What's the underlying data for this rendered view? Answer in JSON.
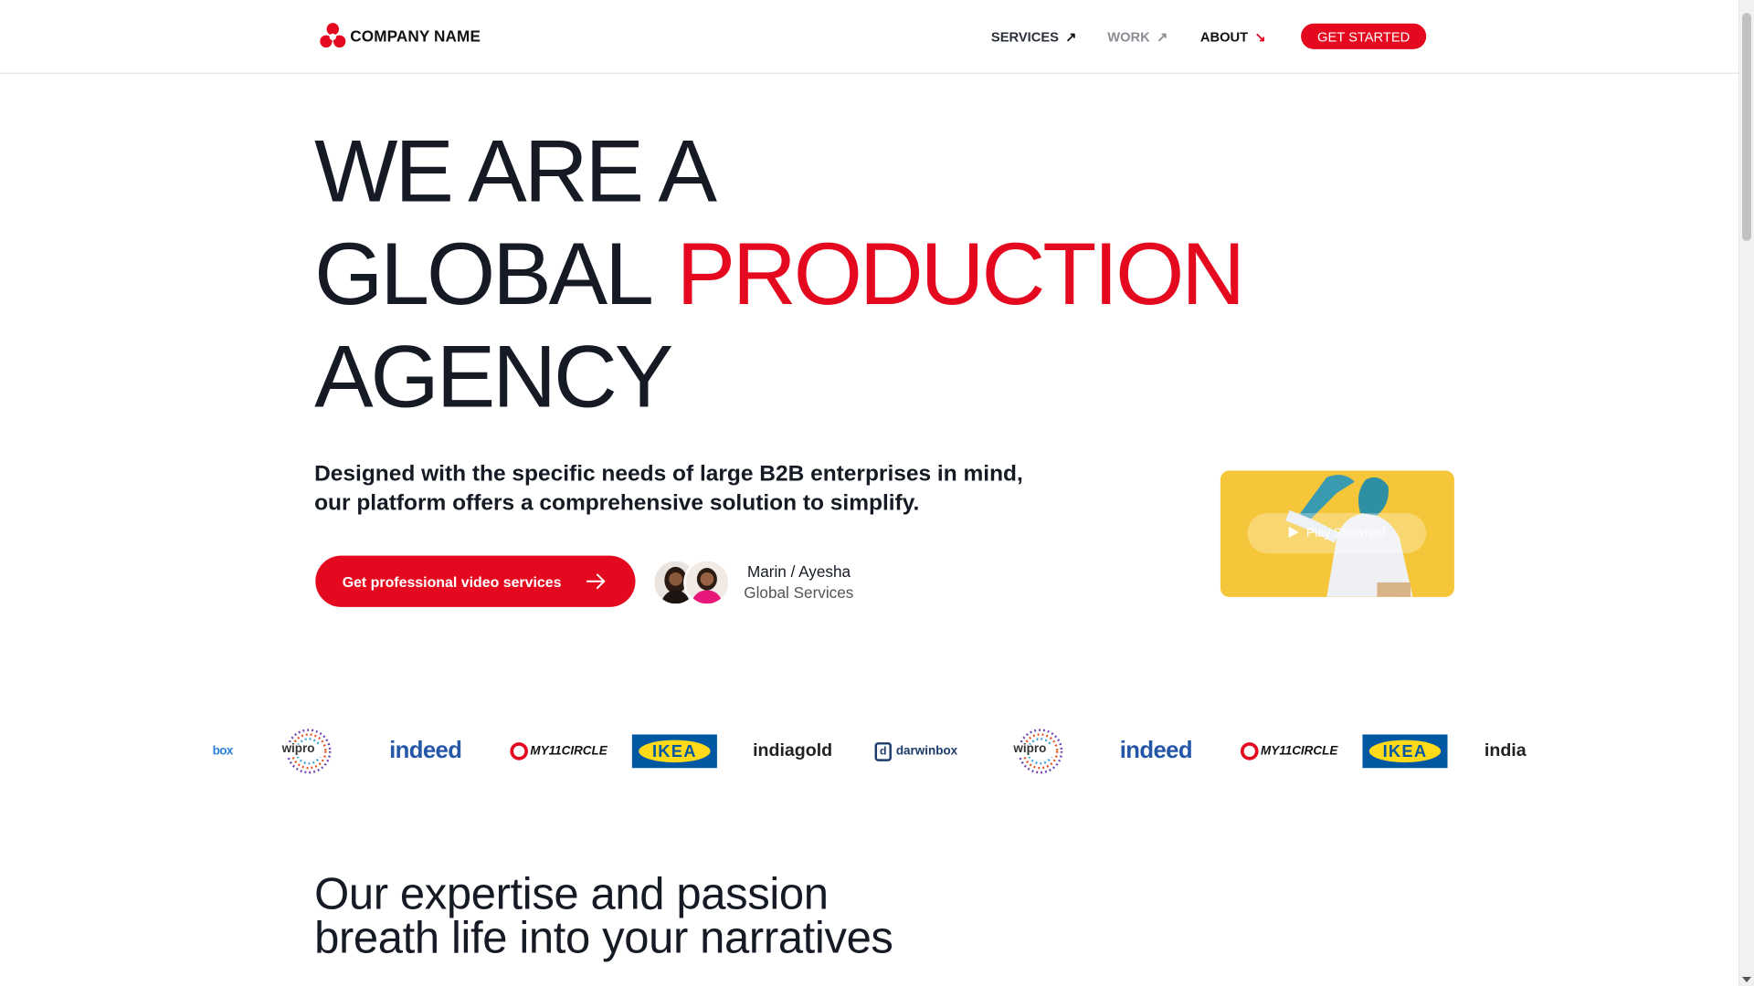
{
  "header": {
    "logo_text": "COMPANY NAME",
    "nav": [
      {
        "label": "SERVICES",
        "arrow": "↗"
      },
      {
        "label": "WORK",
        "arrow": "↗"
      },
      {
        "label": "ABOUT",
        "arrow": "↘"
      }
    ],
    "cta": "GET STARTED"
  },
  "hero": {
    "line1": "WE ARE A",
    "line2a": "GLOBAL",
    "line2b": "PRODUCTION",
    "line3": "AGENCY",
    "subtitle": "Designed with the specific needs of large B2B enterprises in mind, our platform offers a comprehensive solution to simplify.",
    "cta": "Get professional video services",
    "person_name": "Marin / Ayesha",
    "person_role": "Global Services",
    "showreel_label": "Play Showreel"
  },
  "logos": [
    "box",
    "wipro",
    "indeed",
    "MY11CIRCLE",
    "IKEA",
    "indiagold",
    "darwinbox",
    "wipro",
    "indeed",
    "MY11CIRCLE",
    "IKEA",
    "india"
  ],
  "section": {
    "title_line1": "Our expertise and passion",
    "title_line2": "breath life into your narratives"
  },
  "colors": {
    "accent": "#e4091f",
    "text": "#151a24",
    "ikea_blue": "#0058a3",
    "ikea_yellow": "#ffda1a"
  }
}
